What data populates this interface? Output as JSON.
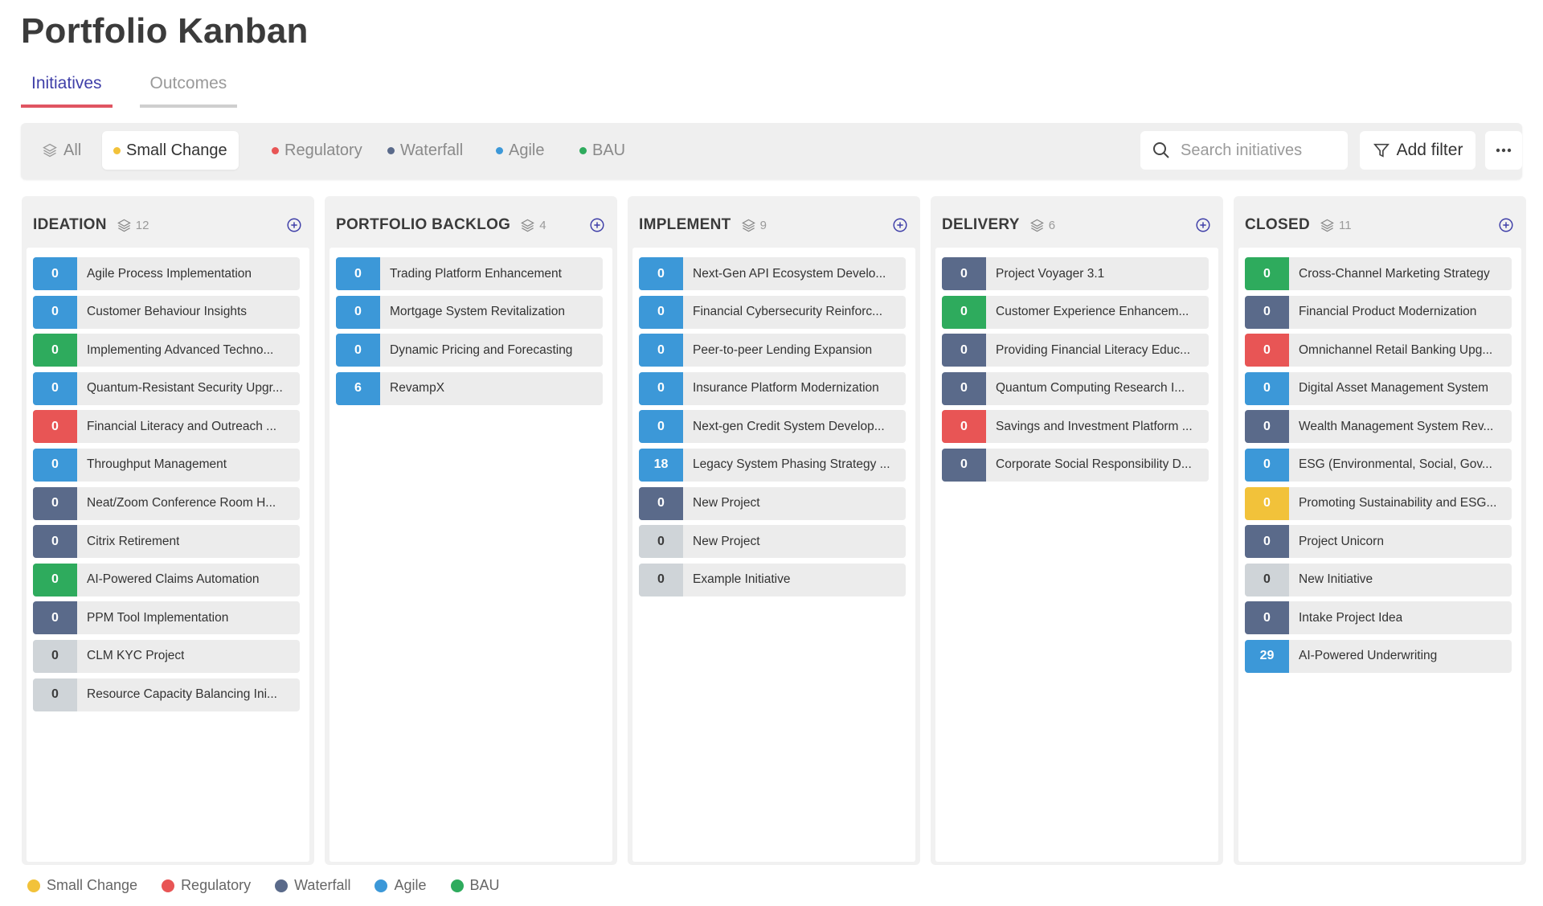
{
  "page": {
    "title": "Portfolio Kanban"
  },
  "tabs": [
    {
      "label": "Initiatives",
      "active": true
    },
    {
      "label": "Outcomes",
      "active": false
    }
  ],
  "colors": {
    "small_change": "#f2c23a",
    "regulatory": "#e85555",
    "waterfall": "#5a6a8a",
    "agile": "#3c98d8",
    "bau": "#2eab5d",
    "grey": "#cfd4d8",
    "accent": "#3f3fa8"
  },
  "filters": {
    "all_label": "All",
    "chips": [
      {
        "label": "Small Change",
        "color": "#f2c23a",
        "active": true
      },
      {
        "label": "Regulatory",
        "color": "#e85555",
        "active": false
      },
      {
        "label": "Waterfall",
        "color": "#5a6a8a",
        "active": false
      },
      {
        "label": "Agile",
        "color": "#3c98d8",
        "active": false
      },
      {
        "label": "BAU",
        "color": "#2eab5d",
        "active": false
      }
    ],
    "search_placeholder": "Search initiatives",
    "add_filter_label": "Add filter"
  },
  "columns": [
    {
      "title": "IDEATION",
      "count": "12",
      "cards": [
        {
          "value": "0",
          "title": "Agile Process Implementation",
          "color": "agile"
        },
        {
          "value": "0",
          "title": "Customer Behaviour Insights",
          "color": "agile"
        },
        {
          "value": "0",
          "title": "Implementing Advanced Techno...",
          "color": "bau"
        },
        {
          "value": "0",
          "title": "Quantum-Resistant Security Upgr...",
          "color": "agile"
        },
        {
          "value": "0",
          "title": "Financial Literacy and Outreach ...",
          "color": "regulatory"
        },
        {
          "value": "0",
          "title": "Throughput Management",
          "color": "agile"
        },
        {
          "value": "0",
          "title": "Neat/Zoom Conference Room H...",
          "color": "waterfall"
        },
        {
          "value": "0",
          "title": "Citrix Retirement",
          "color": "waterfall"
        },
        {
          "value": "0",
          "title": "AI-Powered Claims Automation",
          "color": "bau"
        },
        {
          "value": "0",
          "title": "PPM Tool Implementation",
          "color": "waterfall"
        },
        {
          "value": "0",
          "title": "CLM KYC Project",
          "color": "grey"
        },
        {
          "value": "0",
          "title": "Resource Capacity Balancing Ini...",
          "color": "grey"
        }
      ]
    },
    {
      "title": "PORTFOLIO BACKLOG",
      "count": "4",
      "cards": [
        {
          "value": "0",
          "title": "Trading Platform Enhancement",
          "color": "agile"
        },
        {
          "value": "0",
          "title": "Mortgage System Revitalization",
          "color": "agile"
        },
        {
          "value": "0",
          "title": "Dynamic Pricing and Forecasting",
          "color": "agile"
        },
        {
          "value": "6",
          "title": "RevampX",
          "color": "agile"
        }
      ]
    },
    {
      "title": "IMPLEMENT",
      "count": "9",
      "cards": [
        {
          "value": "0",
          "title": "Next-Gen API Ecosystem Develo...",
          "color": "agile"
        },
        {
          "value": "0",
          "title": "Financial Cybersecurity Reinforc...",
          "color": "agile"
        },
        {
          "value": "0",
          "title": "Peer-to-peer Lending Expansion",
          "color": "agile"
        },
        {
          "value": "0",
          "title": "Insurance Platform Modernization",
          "color": "agile"
        },
        {
          "value": "0",
          "title": "Next-gen Credit System Develop...",
          "color": "agile"
        },
        {
          "value": "18",
          "title": "Legacy System Phasing Strategy ...",
          "color": "agile"
        },
        {
          "value": "0",
          "title": "New Project",
          "color": "waterfall"
        },
        {
          "value": "0",
          "title": "New Project",
          "color": "grey"
        },
        {
          "value": "0",
          "title": "Example Initiative",
          "color": "grey"
        }
      ]
    },
    {
      "title": "DELIVERY",
      "count": "6",
      "cards": [
        {
          "value": "0",
          "title": "Project Voyager 3.1",
          "color": "waterfall"
        },
        {
          "value": "0",
          "title": "Customer Experience Enhancem...",
          "color": "bau"
        },
        {
          "value": "0",
          "title": "Providing Financial Literacy Educ...",
          "color": "waterfall"
        },
        {
          "value": "0",
          "title": "Quantum Computing Research I...",
          "color": "waterfall"
        },
        {
          "value": "0",
          "title": "Savings and Investment Platform ...",
          "color": "regulatory"
        },
        {
          "value": "0",
          "title": "Corporate Social Responsibility D...",
          "color": "waterfall"
        }
      ]
    },
    {
      "title": "CLOSED",
      "count": "11",
      "cards": [
        {
          "value": "0",
          "title": "Cross-Channel Marketing Strategy",
          "color": "bau"
        },
        {
          "value": "0",
          "title": "Financial Product Modernization",
          "color": "waterfall"
        },
        {
          "value": "0",
          "title": "Omnichannel Retail Banking Upg...",
          "color": "regulatory"
        },
        {
          "value": "0",
          "title": "Digital Asset Management System",
          "color": "agile"
        },
        {
          "value": "0",
          "title": "Wealth Management System Rev...",
          "color": "waterfall"
        },
        {
          "value": "0",
          "title": "ESG (Environmental, Social, Gov...",
          "color": "agile"
        },
        {
          "value": "0",
          "title": "Promoting Sustainability and ESG...",
          "color": "small_change"
        },
        {
          "value": "0",
          "title": "Project Unicorn",
          "color": "waterfall"
        },
        {
          "value": "0",
          "title": "New Initiative",
          "color": "grey"
        },
        {
          "value": "0",
          "title": "Intake Project Idea",
          "color": "waterfall"
        },
        {
          "value": "29",
          "title": "AI-Powered Underwriting",
          "color": "agile"
        }
      ]
    }
  ],
  "legend": [
    {
      "label": "Small Change",
      "color": "#f2c23a"
    },
    {
      "label": "Regulatory",
      "color": "#e85555"
    },
    {
      "label": "Waterfall",
      "color": "#5a6a8a"
    },
    {
      "label": "Agile",
      "color": "#3c98d8"
    },
    {
      "label": "BAU",
      "color": "#2eab5d"
    }
  ]
}
